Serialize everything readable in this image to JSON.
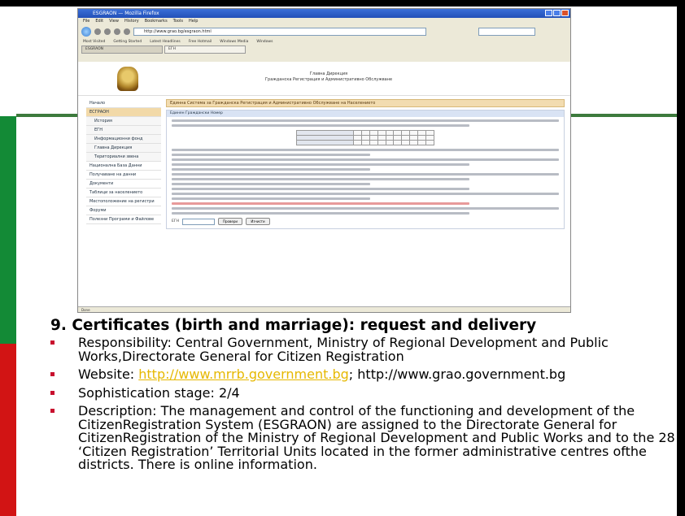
{
  "browser": {
    "window_title": "ESGRAON — Mozilla Firefox",
    "menu": [
      "File",
      "Edit",
      "View",
      "History",
      "Bookmarks",
      "Tools",
      "Help"
    ],
    "url": "http://www.grao.bg/esgraon.html",
    "bookmarks": [
      "Most Visited",
      "Getting Started",
      "Latest Headlines",
      "Free Hotmail",
      "Windows Media",
      "Windows"
    ],
    "tabs": [
      "ESGRAON",
      "ЕГН"
    ],
    "page": {
      "header_line1": "Главна Дирекция",
      "header_line2": "Гражданска Регистрация и Административно Обслужване",
      "sidebar": [
        {
          "label": "Начало",
          "state": "normal"
        },
        {
          "label": "ЕСГРАОН",
          "state": "selected"
        },
        {
          "label": "История",
          "state": "sub"
        },
        {
          "label": "ЕГН",
          "state": "sub"
        },
        {
          "label": "Информационни фонд",
          "state": "sub"
        },
        {
          "label": "Главна Дирекция",
          "state": "sub"
        },
        {
          "label": "Териториални звена",
          "state": "sub"
        },
        {
          "label": "Национална База Данни",
          "state": "normal"
        },
        {
          "label": "Получаване на данни",
          "state": "normal"
        },
        {
          "label": "Документи",
          "state": "normal"
        },
        {
          "label": "Таблици за населението",
          "state": "normal"
        },
        {
          "label": "Местоположение на регистри",
          "state": "normal"
        },
        {
          "label": "Форуми",
          "state": "normal"
        },
        {
          "label": "Полезни Програми и Файлове",
          "state": "normal"
        }
      ],
      "main_title": "Единна Система за Гражданска Регистрация и Административно Обслужване на Населението",
      "box_title": "Единен Граждански Номер",
      "form_label": "ЕГН",
      "check_button": "Провери",
      "clear_button": "Изчисти"
    },
    "status": "Done"
  },
  "slide": {
    "title": "9. Certificates (birth and marriage): request and delivery",
    "bullets": [
      {
        "id": "responsibility",
        "text": "Responsibility: Central Government, Ministry of Regional Development and Public Works,Directorate General for Citizen Registration"
      },
      {
        "id": "website",
        "prefix": "Website: ",
        "link": "http://www.mrrb.government.bg",
        "suffix": "; http://www.grao.government.bg"
      },
      {
        "id": "sophistication",
        "text": "Sophistication stage: 2/4"
      },
      {
        "id": "description",
        "text": "Description: The management and control of the functioning and development of the CitizenRegistration System (ESGRAON) are assigned to the Directorate General for CitizenRegistration of the Ministry of Regional Development and Public Works and to the 28 ‘Citizen Registration’ Territorial Units located in the former administrative centres ofthe districts. There is online information."
      }
    ]
  },
  "colors": {
    "flag_white": "#ffffff",
    "flag_green": "#138a36",
    "flag_red": "#d21414",
    "bullet": "#c8102e",
    "link": "#e6b800"
  }
}
